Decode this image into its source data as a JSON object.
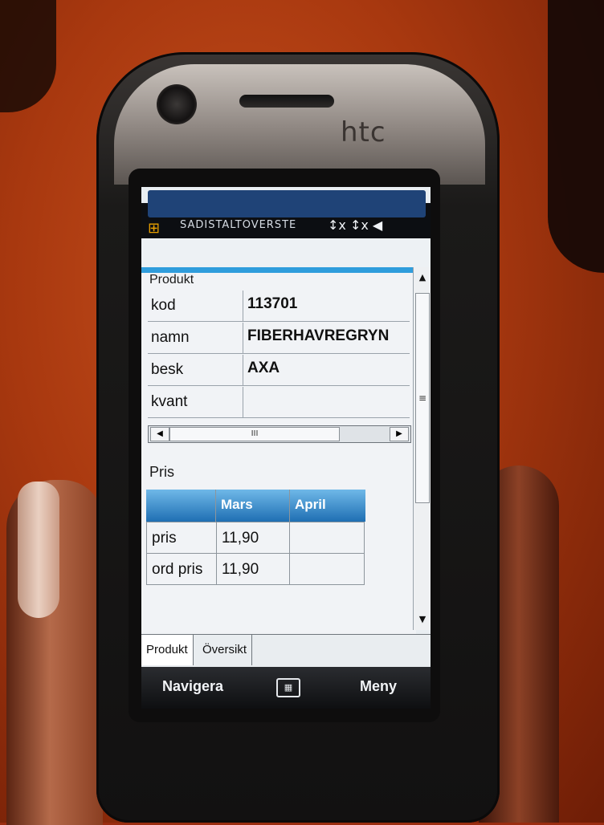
{
  "device": {
    "brand": "htc"
  },
  "statusbar": {
    "title": "SADISTALTOVERSTE",
    "tray": "↕x ↕x ◀"
  },
  "produkt": {
    "section_label": "Produkt",
    "rows": [
      {
        "key": "kod",
        "value": "113701"
      },
      {
        "key": "namn",
        "value": "FIBERHAVREGRYN"
      },
      {
        "key": "besk",
        "value": "AXA"
      },
      {
        "key": "kvant",
        "value": ""
      }
    ],
    "scroll_thumb_label": "III"
  },
  "pris": {
    "section_label": "Pris",
    "columns": [
      "",
      "Mars",
      "April"
    ],
    "rows": [
      {
        "label": "pris",
        "mars": "11,90",
        "april": ""
      },
      {
        "label": "ord pris",
        "mars": "11,90",
        "april": ""
      }
    ]
  },
  "tabs": [
    {
      "label": "Produkt",
      "active": true
    },
    {
      "label": "Översikt",
      "active": false
    }
  ],
  "softkeys": {
    "left": "Navigera",
    "right": "Meny",
    "center_icon": "keyboard-icon"
  },
  "colors": {
    "title_overlay": "#1f4377",
    "accent_line": "#2f9ddc",
    "table_header": "#1f6fb3"
  }
}
